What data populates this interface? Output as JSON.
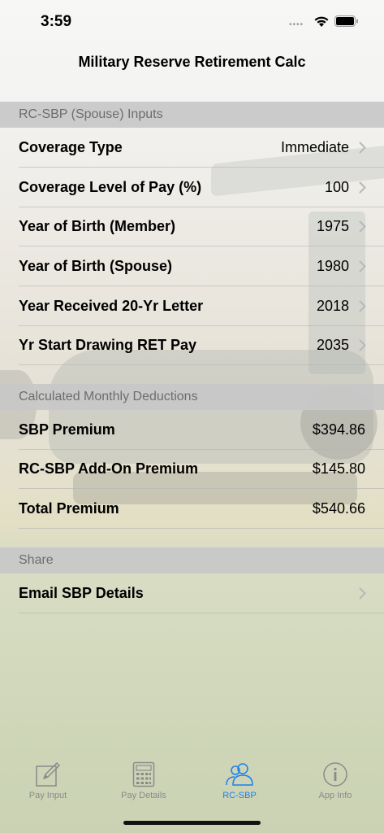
{
  "status_bar": {
    "time": "3:59",
    "signal": "••••"
  },
  "nav": {
    "title": "Military Reserve Retirement Calc"
  },
  "sections": {
    "inputs": {
      "header": "RC-SBP (Spouse) Inputs",
      "rows": [
        {
          "label": "Coverage Type",
          "value": "Immediate"
        },
        {
          "label": "Coverage Level of Pay (%)",
          "value": "100"
        },
        {
          "label": "Year of Birth (Member)",
          "value": "1975"
        },
        {
          "label": "Year of Birth (Spouse)",
          "value": "1980"
        },
        {
          "label": "Year Received 20-Yr Letter",
          "value": "2018"
        },
        {
          "label": "Yr Start Drawing RET Pay",
          "value": "2035"
        }
      ]
    },
    "deductions": {
      "header": "Calculated Monthly Deductions",
      "rows": [
        {
          "label": "SBP Premium",
          "value": "$394.86"
        },
        {
          "label": "RC-SBP Add-On Premium",
          "value": "$145.80"
        },
        {
          "label": "Total Premium",
          "value": "$540.66"
        }
      ]
    },
    "share": {
      "header": "Share",
      "rows": [
        {
          "label": "Email SBP Details"
        }
      ]
    }
  },
  "tabs": [
    {
      "label": "Pay Input",
      "icon": "pencil-square-icon",
      "active": false
    },
    {
      "label": "Pay Details",
      "icon": "calculator-icon",
      "active": false
    },
    {
      "label": "RC-SBP",
      "icon": "people-icon",
      "active": true
    },
    {
      "label": "App Info",
      "icon": "info-circle-icon",
      "active": false
    }
  ],
  "colors": {
    "accent": "#1a7ff0",
    "inactive_tab": "#8a8a8a",
    "section_header_bg": "#c8c8c8",
    "section_header_text": "#6d6d6d"
  }
}
